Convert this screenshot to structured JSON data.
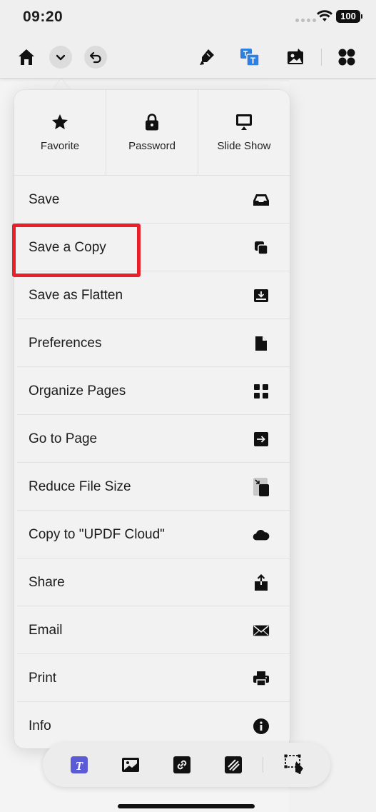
{
  "status": {
    "time": "09:20",
    "battery": "100"
  },
  "toolbar": {
    "icons": [
      "home-icon",
      "chevron-down-icon",
      "undo-icon",
      "highlighter-icon",
      "translate-icon",
      "edit-image-icon",
      "apps-grid-icon"
    ]
  },
  "menu": {
    "top": [
      {
        "label": "Favorite",
        "icon": "star-icon"
      },
      {
        "label": "Password",
        "icon": "lock-icon"
      },
      {
        "label": "Slide Show",
        "icon": "slideshow-icon"
      }
    ],
    "items": [
      {
        "label": "Save",
        "icon": "tray-icon"
      },
      {
        "label": "Save a Copy",
        "icon": "copy-icon"
      },
      {
        "label": "Save as Flatten",
        "icon": "flatten-icon"
      },
      {
        "label": "Preferences",
        "icon": "document-icon"
      },
      {
        "label": "Organize Pages",
        "icon": "grid-icon"
      },
      {
        "label": "Go to Page",
        "icon": "goto-icon"
      },
      {
        "label": "Reduce File Size",
        "icon": "compress-icon"
      },
      {
        "label": "Copy to \"UPDF Cloud\"",
        "icon": "cloud-icon"
      },
      {
        "label": "Share",
        "icon": "share-icon"
      },
      {
        "label": "Email",
        "icon": "mail-icon"
      },
      {
        "label": "Print",
        "icon": "printer-icon"
      },
      {
        "label": "Info",
        "icon": "info-icon"
      }
    ]
  },
  "colors": {
    "highlight": "#e8202a",
    "accent": "#5b5bd6",
    "blue": "#2f7fe0"
  }
}
